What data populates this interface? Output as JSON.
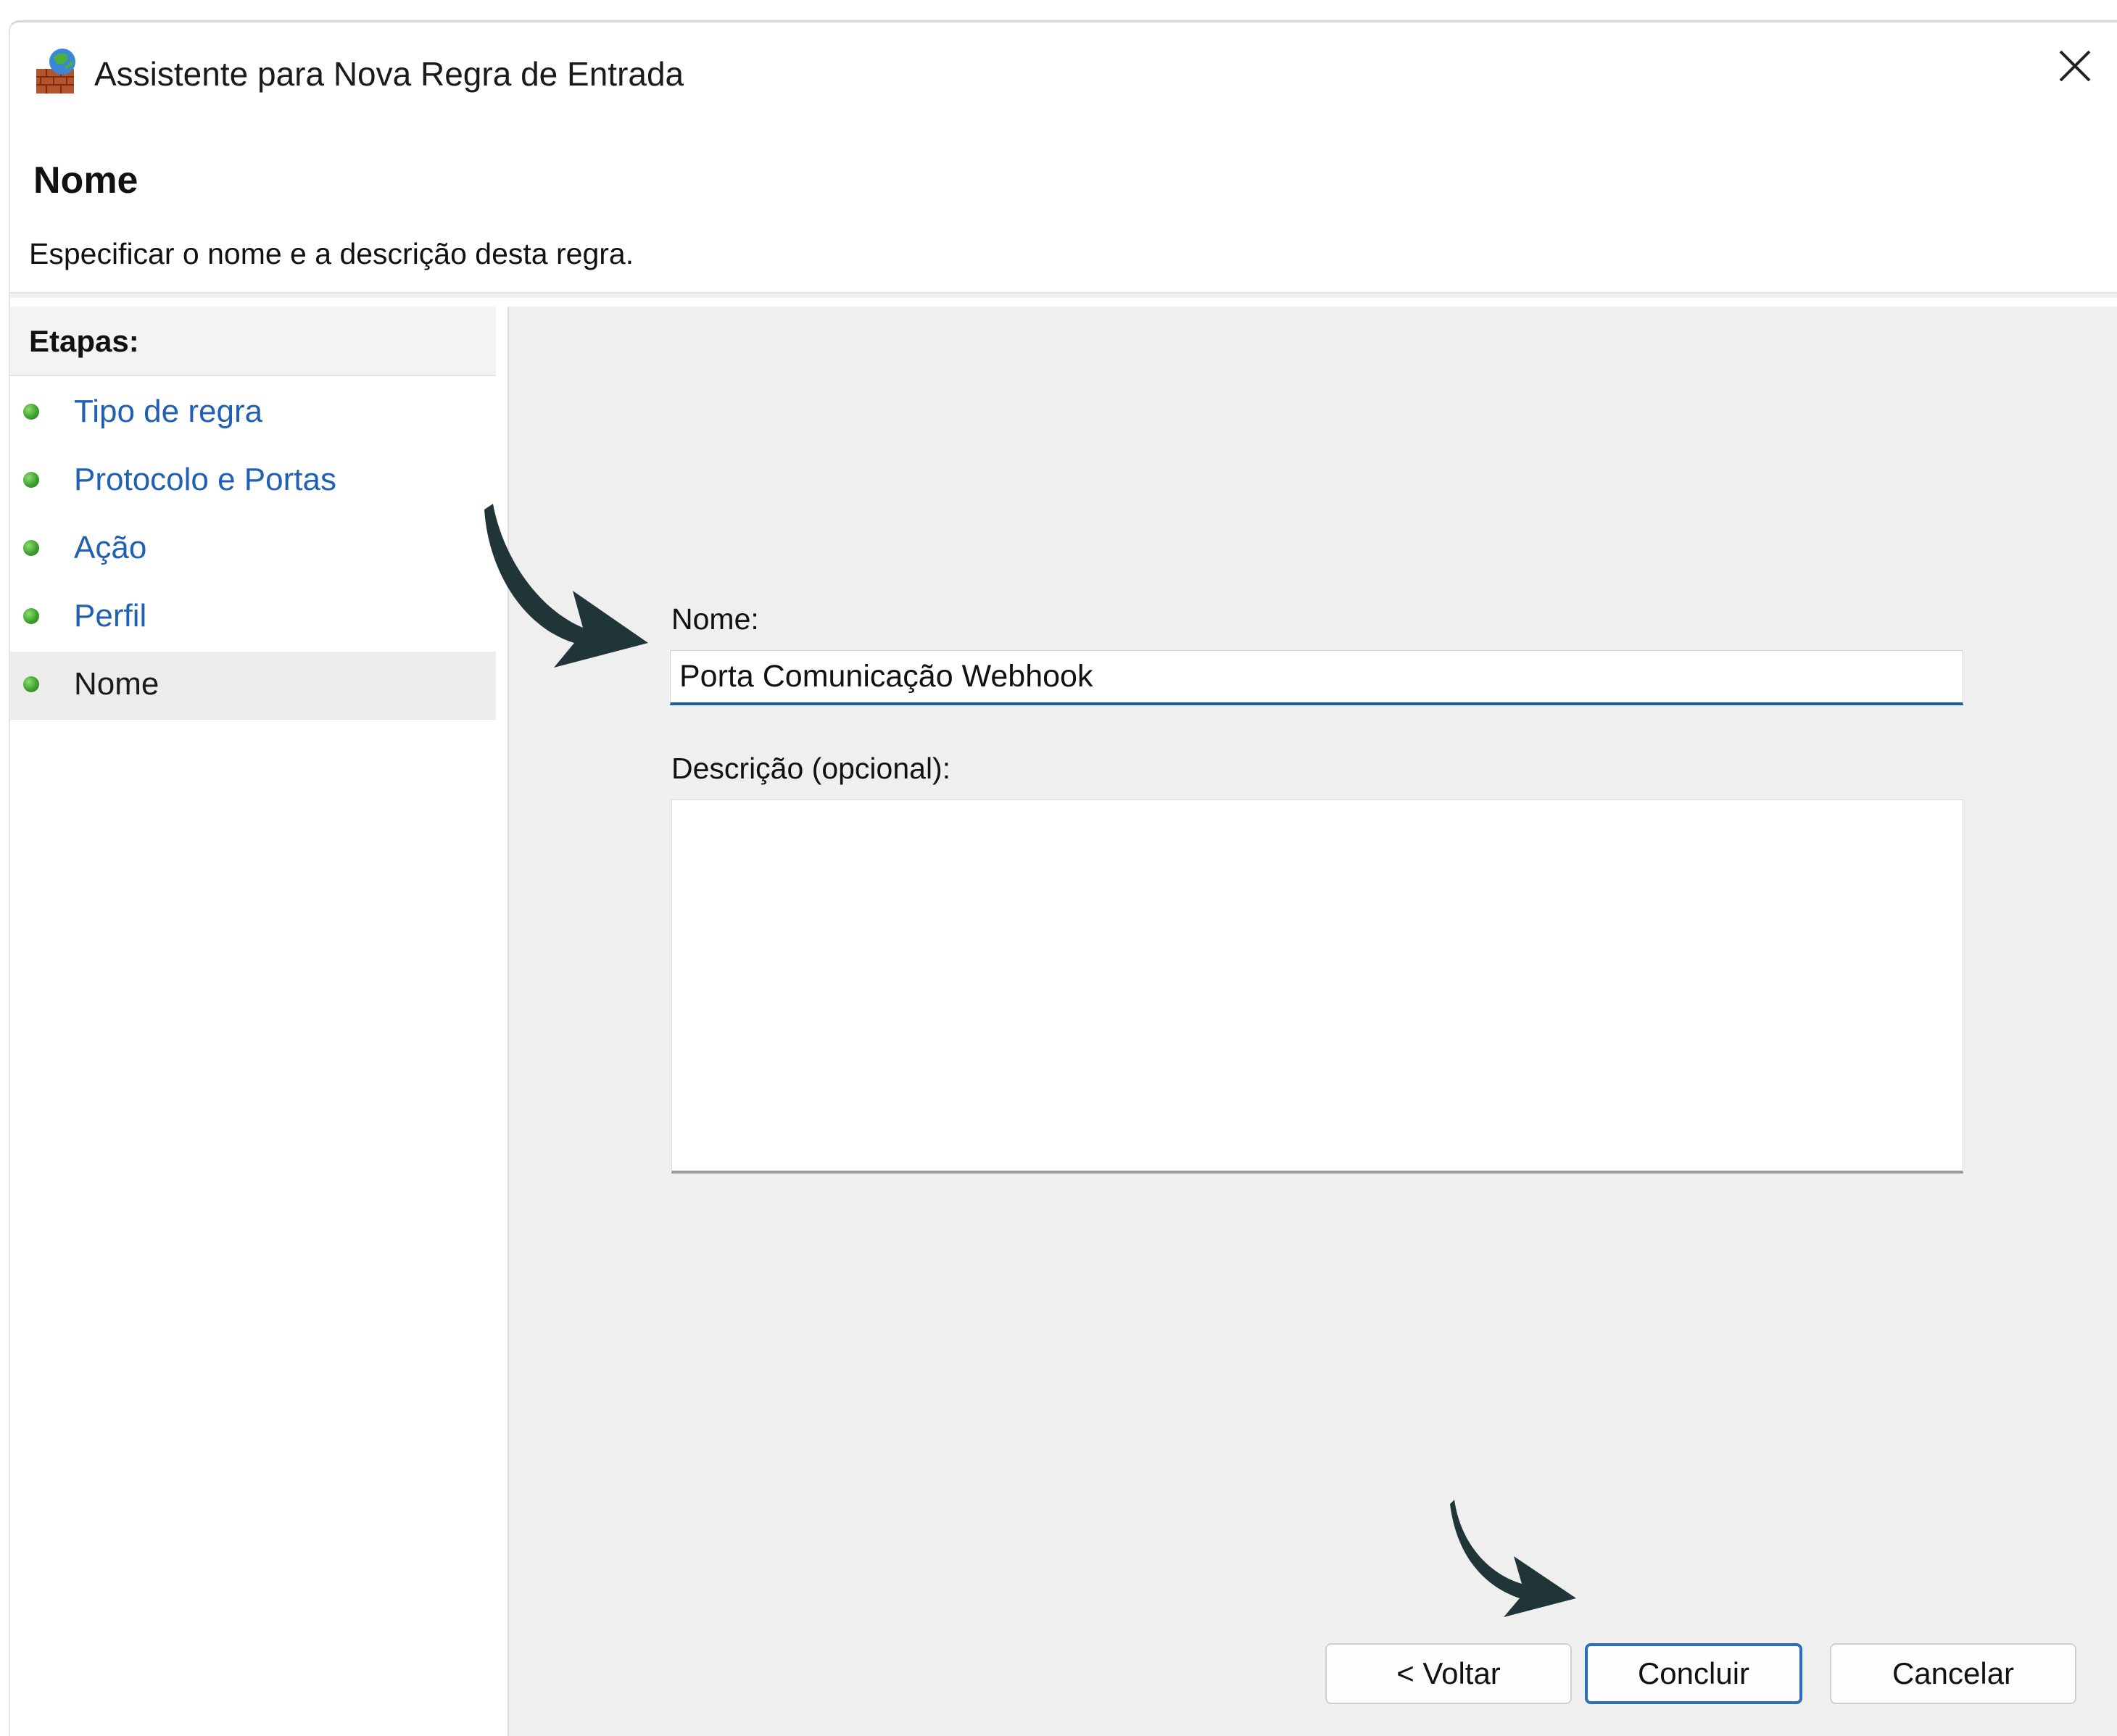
{
  "window": {
    "title": "Assistente para Nova Regra de Entrada"
  },
  "header": {
    "heading": "Nome",
    "subtitle": "Especificar o nome e a descrição desta regra."
  },
  "sidebar": {
    "title": "Etapas:",
    "steps": [
      {
        "label": "Tipo de regra",
        "current": false
      },
      {
        "label": "Protocolo e Portas",
        "current": false
      },
      {
        "label": "Ação",
        "current": false
      },
      {
        "label": "Perfil",
        "current": false
      },
      {
        "label": "Nome",
        "current": true
      }
    ]
  },
  "form": {
    "name_label": "Nome:",
    "name_value": "Porta Comunicação Webhook",
    "description_label": "Descrição (opcional):",
    "description_value": ""
  },
  "buttons": {
    "back_label": "< Voltar",
    "finish_label": "Concluir",
    "cancel_label": "Cancelar"
  },
  "colors": {
    "link_blue": "#1f5fb4",
    "input_focus_blue": "#1a5fa8",
    "annotation_arrow": "#1f3537",
    "step_dot_green": "#3fa02e"
  },
  "icons": {
    "app": "firewall-icon",
    "close": "close-icon",
    "step": "green-dot-icon",
    "annotation": "curved-arrow-icon"
  }
}
